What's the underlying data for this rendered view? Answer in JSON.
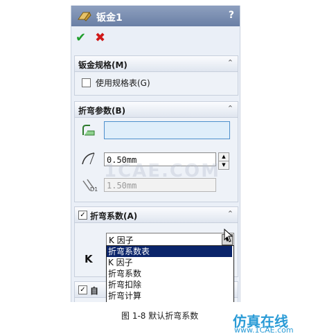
{
  "window": {
    "title": "钣金1",
    "help": "?"
  },
  "actions": {
    "ok": "✔",
    "cancel": "✖"
  },
  "sheet_metal_gauges": {
    "title": "钣金规格(M)",
    "use_gauge_table_label": "使用规格表(G)",
    "use_gauge_table_checked": false
  },
  "bend_parameters": {
    "title": "折弯参数(B)",
    "face_field_value": "",
    "radius_value": "0.50mm",
    "thickness_value": "1.50mm",
    "thickness_symbol": "D1"
  },
  "bend_allowance": {
    "title": "折弯系数(A)",
    "enabled": true,
    "k_label": "K",
    "selected": "K 因子",
    "options": [
      "折弯系数表",
      "K 因子",
      "折弯系数",
      "折弯扣除",
      "折弯计算"
    ],
    "highlighted_option": "折弯系数表"
  },
  "next_section": {
    "label": "自"
  },
  "caption": "图 1-8  默认折弯系数",
  "watermark": {
    "text": "仿真在线",
    "url": "www.1CAE.com",
    "center": "1CAE.COM"
  },
  "colors": {
    "title_bar": "#7589ad",
    "highlight": "#0a246a",
    "field_blue": "#dfeefa",
    "ok": "#1f9e2c",
    "cancel": "#d01919"
  }
}
